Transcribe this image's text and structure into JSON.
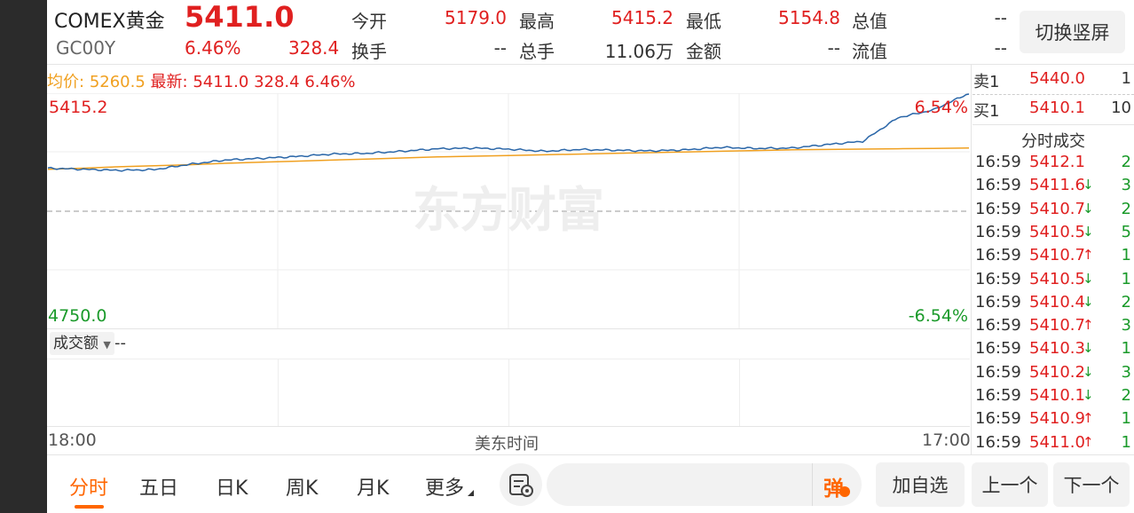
{
  "quote": {
    "name": "COMEX黄金",
    "code": "GC00Y",
    "price": "5411.0",
    "change_pct": "6.46%",
    "change": "328.4",
    "switch_button": "切换竖屏",
    "stats": [
      {
        "label": "今开",
        "value": "5179.0"
      },
      {
        "label": "最高",
        "value": "5415.2"
      },
      {
        "label": "最低",
        "value": "5154.8"
      },
      {
        "label": "总值",
        "value": "--"
      },
      {
        "label": "换手",
        "value": "--"
      },
      {
        "label": "总手",
        "value": "11.06万"
      },
      {
        "label": "金额",
        "value": "--"
      },
      {
        "label": "流值",
        "value": "--"
      }
    ]
  },
  "chart_info": {
    "avg_label": "均价:",
    "avg_value": "5260.5",
    "latest_label": "最新:",
    "latest_value": "5411.0",
    "latest_change": "328.4",
    "latest_pct": "6.46%"
  },
  "chart_data": {
    "type": "line",
    "y_max_label": "5415.2",
    "y_min_label": "4750.0",
    "pct_top": "6.54%",
    "pct_bottom": "-6.54%",
    "x_start": "18:00",
    "x_mid": "美东时间",
    "x_end": "17:00",
    "watermark": "东方财富",
    "ylim": [
      4750.0,
      5415.2
    ],
    "series": [
      {
        "values": [
          5203,
          5200,
          5197,
          5199,
          5214,
          5226,
          5231,
          5236,
          5243,
          5245,
          5251,
          5258,
          5260,
          5257,
          5251,
          5256,
          5254,
          5252,
          5255,
          5262,
          5259,
          5260,
          5270,
          5279,
          5346,
          5368,
          5415
        ]
      },
      {
        "values": [
          5200,
          5203,
          5207,
          5210,
          5213,
          5217,
          5220,
          5223,
          5226,
          5229,
          5232,
          5235,
          5237,
          5239,
          5241,
          5243,
          5245,
          5247,
          5249,
          5251,
          5253,
          5255,
          5256,
          5257,
          5258,
          5259,
          5260
        ]
      }
    ]
  },
  "volume_panel": {
    "selector": "成交额",
    "value": "--"
  },
  "order_book": {
    "sell": {
      "label": "卖1",
      "price": "5440.0",
      "qty": "1"
    },
    "buy": {
      "label": "买1",
      "price": "5410.1",
      "qty": "10"
    }
  },
  "trades_title": "分时成交",
  "trades": [
    {
      "time": "16:59",
      "price": "5412.1",
      "arrow": "",
      "qty": "2"
    },
    {
      "time": "16:59",
      "price": "5411.6",
      "arrow": "↓",
      "qty": "3"
    },
    {
      "time": "16:59",
      "price": "5410.7",
      "arrow": "↓",
      "qty": "2"
    },
    {
      "time": "16:59",
      "price": "5410.5",
      "arrow": "↓",
      "qty": "5"
    },
    {
      "time": "16:59",
      "price": "5410.7",
      "arrow": "↑",
      "qty": "1"
    },
    {
      "time": "16:59",
      "price": "5410.5",
      "arrow": "↓",
      "qty": "1"
    },
    {
      "time": "16:59",
      "price": "5410.4",
      "arrow": "↓",
      "qty": "2"
    },
    {
      "time": "16:59",
      "price": "5410.7",
      "arrow": "↑",
      "qty": "3"
    },
    {
      "time": "16:59",
      "price": "5410.3",
      "arrow": "↓",
      "qty": "1"
    },
    {
      "time": "16:59",
      "price": "5410.2",
      "arrow": "↓",
      "qty": "3"
    },
    {
      "time": "16:59",
      "price": "5410.1",
      "arrow": "↓",
      "qty": "2"
    },
    {
      "time": "16:59",
      "price": "5410.9",
      "arrow": "↑",
      "qty": "1"
    },
    {
      "time": "16:59",
      "price": "5411.0",
      "arrow": "↑",
      "qty": "1"
    }
  ],
  "tabs": [
    "分时",
    "五日",
    "日K",
    "周K",
    "月K",
    "更多"
  ],
  "bottom": {
    "danmu_icon": "弹",
    "add_watchlist": "加自选",
    "prev": "上一个",
    "next": "下一个"
  },
  "colors": {
    "up": "#e02020",
    "down": "#1a9a2a",
    "price_line": "#2a66a8",
    "avg_line": "#f0a020",
    "accent": "#ff6600"
  }
}
